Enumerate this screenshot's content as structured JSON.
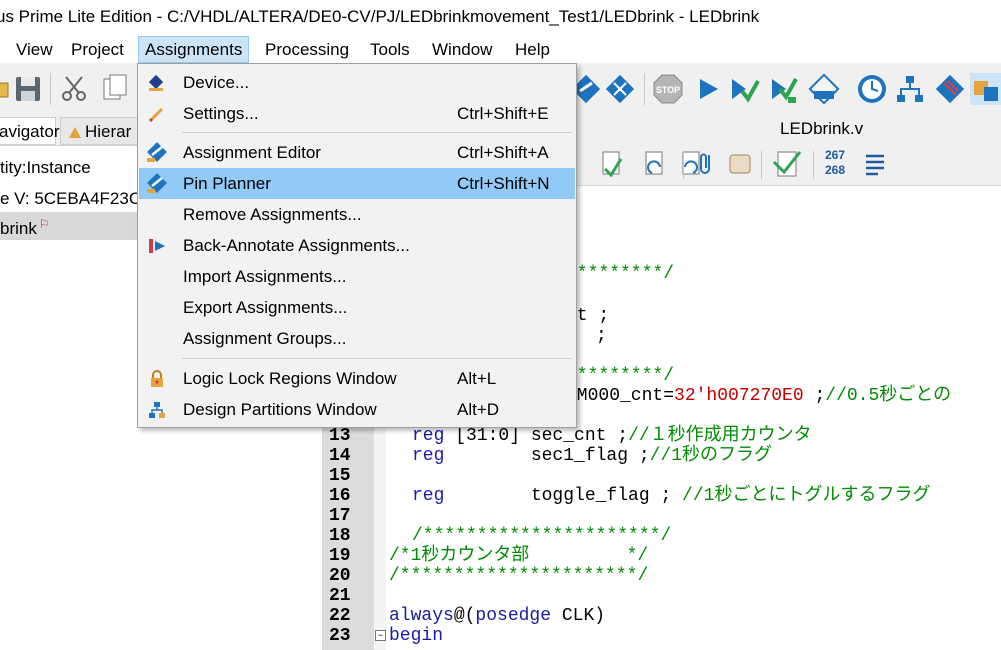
{
  "window": {
    "title": "us Prime Lite Edition - C:/VHDL/ALTERA/DE0-CV/PJ/LEDbrinkmovement_Test1/LEDbrink - LEDbrink"
  },
  "menubar": {
    "items": [
      {
        "label": "View"
      },
      {
        "label": "Project"
      },
      {
        "label": "Assignments"
      },
      {
        "label": "Processing"
      },
      {
        "label": "Tools"
      },
      {
        "label": "Window"
      },
      {
        "label": "Help"
      }
    ]
  },
  "assignments_menu": {
    "items": [
      {
        "label": "Device...",
        "shortcut": ""
      },
      {
        "label": "Settings...",
        "shortcut": "Ctrl+Shift+E"
      },
      {
        "label": "Assignment Editor",
        "shortcut": "Ctrl+Shift+A"
      },
      {
        "label": "Pin Planner",
        "shortcut": "Ctrl+Shift+N"
      },
      {
        "label": "Remove Assignments...",
        "shortcut": ""
      },
      {
        "label": "Back-Annotate Assignments...",
        "shortcut": ""
      },
      {
        "label": "Import Assignments...",
        "shortcut": ""
      },
      {
        "label": "Export Assignments...",
        "shortcut": ""
      },
      {
        "label": "Assignment Groups...",
        "shortcut": ""
      },
      {
        "label": "Logic Lock Regions Window",
        "shortcut": "Alt+L"
      },
      {
        "label": "Design Partitions Window",
        "shortcut": "Alt+D"
      }
    ]
  },
  "left_panel": {
    "tabs": [
      {
        "label": "avigator"
      },
      {
        "label": "Hierar"
      }
    ],
    "header": "tity:Instance",
    "device": "e V: 5CEBA4F23C",
    "entity": "brink"
  },
  "editor": {
    "tab_label": "LEDbrink.v",
    "line_counter_top": "267",
    "line_counter_bottom": "268",
    "code_fragments": {
      "f1": "*********/",
      "f2": "nt ;",
      "f3": ";",
      "f4": "*********/",
      "f5_pre": "3M000_cnt=",
      "f5_num": "32'h007270E0",
      "f5_post": " ;",
      "f5_comment": "//0.5秒ごとの"
    },
    "lines": [
      {
        "no": "13",
        "kw": "reg",
        "range": " [31:0]",
        "rest": " sec_cnt ;",
        "comment": "//１秒作成用カウンタ"
      },
      {
        "no": "14",
        "kw": "reg",
        "rest": "        sec1_flag ;",
        "comment": "//1秒のフラグ"
      },
      {
        "no": "15"
      },
      {
        "no": "16",
        "kw": "reg",
        "rest": "        toggle_flag ; ",
        "comment": "//1秒ごとにトグルするフラグ"
      },
      {
        "no": "17"
      },
      {
        "no": "18",
        "comment": "/**********************/"
      },
      {
        "no": "19",
        "comment": "/*1秒カウンタ部         */"
      },
      {
        "no": "20",
        "comment": "/**********************/"
      },
      {
        "no": "21"
      },
      {
        "no": "22",
        "kw": "always",
        "rest": "@(",
        "kw2": "posedge",
        "rest2": " CLK)"
      },
      {
        "no": "23",
        "kw": "begin"
      }
    ]
  },
  "colors": {
    "keyword": "#1a1aa6",
    "comment": "#008c00",
    "number": "#c00000",
    "highlight": "#91c9f7"
  }
}
